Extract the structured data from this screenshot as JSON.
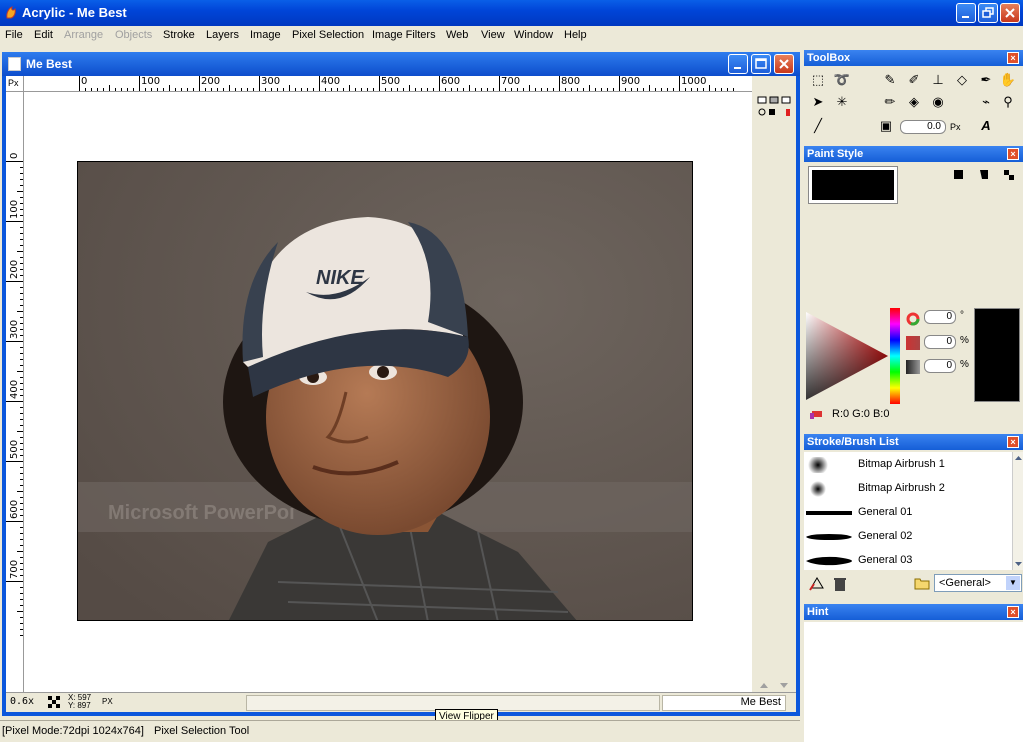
{
  "app": {
    "title": "Acrylic - Me Best"
  },
  "menu": [
    {
      "label": "File",
      "disabled": false
    },
    {
      "label": "Edit",
      "disabled": false
    },
    {
      "label": "Arrange",
      "disabled": true
    },
    {
      "label": "Objects",
      "disabled": true
    },
    {
      "label": "Stroke",
      "disabled": false
    },
    {
      "label": "Layers",
      "disabled": false
    },
    {
      "label": "Image",
      "disabled": false
    },
    {
      "label": "Pixel Selection",
      "disabled": false
    },
    {
      "label": "Image Filters",
      "disabled": false
    },
    {
      "label": "Web",
      "disabled": false
    },
    {
      "label": "View",
      "disabled": false
    },
    {
      "label": "Window",
      "disabled": false
    },
    {
      "label": "Help",
      "disabled": false
    }
  ],
  "document": {
    "title": "Me Best",
    "ruler_unit": "Px",
    "h_ruler_labels": [
      "0",
      "100",
      "200",
      "300",
      "400",
      "500",
      "600",
      "700",
      "800",
      "900",
      "1000"
    ],
    "v_ruler_labels": [
      "0",
      "100",
      "200",
      "300",
      "400",
      "500",
      "600",
      "700"
    ],
    "zoom": "0.6x",
    "coord_x": "X: 597",
    "coord_y": "Y: 897",
    "coord_unit": "PX",
    "name_box": "Me Best",
    "photo_text": {
      "cap_logo": "NIKE",
      "background_text": "Microsoft PowerPoi"
    }
  },
  "tooltip": "View Flipper",
  "status": {
    "mode": "[Pixel Mode:72dpi 1024x764]",
    "tool": "Pixel Selection Tool"
  },
  "panels": {
    "toolbox": {
      "title": "ToolBox",
      "size_value": "0.0",
      "size_unit": "Px"
    },
    "paint_style": {
      "title": "Paint Style",
      "hue_value": "0",
      "hue_unit": "°",
      "sat_value": "0",
      "sat_unit": "%",
      "bright_value": "0",
      "bright_unit": "%",
      "rgb_readout": "R:0 G:0 B:0",
      "current_color": "#000000"
    },
    "brush_list": {
      "title": "Stroke/Brush List",
      "items": [
        {
          "name": "Bitmap Airbrush 1"
        },
        {
          "name": "Bitmap Airbrush 2"
        },
        {
          "name": "General 01"
        },
        {
          "name": "General 02"
        },
        {
          "name": "General 03"
        }
      ],
      "category": "<General>"
    },
    "hint": {
      "title": "Hint"
    }
  }
}
